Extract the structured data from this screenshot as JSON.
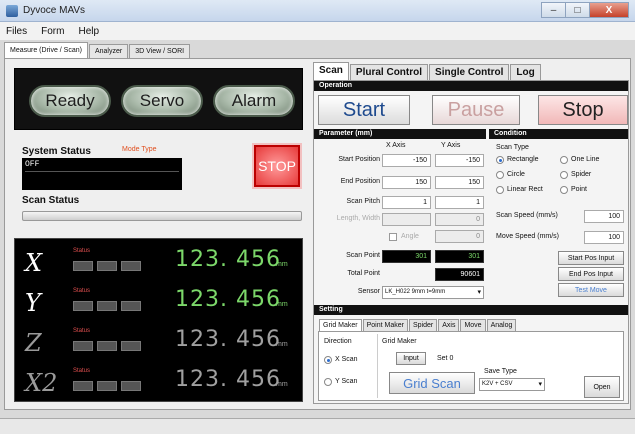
{
  "window": {
    "title": "Dyvoce MAVs",
    "minimize": "–",
    "maximize": "□",
    "close": "X"
  },
  "menu": [
    "Files",
    "Form",
    "Help"
  ],
  "top_tabs": [
    "Measure (Drive / Scan)",
    "Analyzer",
    "3D View / SORI"
  ],
  "lamps": {
    "ready": "Ready",
    "servo": "Servo",
    "alarm": "Alarm"
  },
  "system": {
    "label": "System Status",
    "mode_type": "Mode Type",
    "value": "OFF",
    "stop": "STOP"
  },
  "scan_status": {
    "label": "Scan Status"
  },
  "axes": [
    {
      "name": "X",
      "status": "Status",
      "value": "123. 456",
      "unit": "mm",
      "active": true
    },
    {
      "name": "Y",
      "status": "Status",
      "value": "123. 456",
      "unit": "mm",
      "active": true
    },
    {
      "name": "Z",
      "status": "Status",
      "value": "123. 456",
      "unit": "mm",
      "active": false
    },
    {
      "name": "X2",
      "status": "Status",
      "value": "123. 456",
      "unit": "mm",
      "active": false
    }
  ],
  "right_tabs": [
    "Scan",
    "Plural Control",
    "Single Control",
    "Log"
  ],
  "operation": {
    "header": "Operation",
    "start": "Start",
    "pause": "Pause",
    "stop": "Stop"
  },
  "parameter": {
    "header": "Parameter (mm)",
    "x_axis": "X Axis",
    "y_axis": "Y Axis",
    "start_position": {
      "label": "Start Position",
      "x": "-150",
      "y": "-150"
    },
    "end_position": {
      "label": "End  Position",
      "x": "150",
      "y": "150"
    },
    "scan_pitch": {
      "label": "Scan Pitch",
      "x": "1",
      "y": "1"
    },
    "length_width": {
      "label": "Length, Width",
      "y": "0"
    },
    "angle": {
      "label": "Angle",
      "y": "0"
    },
    "scan_point": {
      "label": "Scan Point",
      "x": "301",
      "y": "301"
    },
    "total_point": {
      "label": "Total Point",
      "value": "90601"
    },
    "sensor": {
      "label": "Sensor",
      "value": "LK_H022 9mm t=9mm"
    }
  },
  "condition": {
    "header": "Condition",
    "scan_type": "Scan Type",
    "options": [
      "Rectangle",
      "One Line",
      "Circle",
      "Spider",
      "Linear Rect",
      "Point"
    ],
    "selected": "Rectangle",
    "scan_speed": {
      "label": "Scan Speed (mm/s)",
      "value": "100"
    },
    "move_speed": {
      "label": "Move Speed (mm/s)",
      "value": "100"
    },
    "start_pos_input": "Start Pos Input",
    "end_pos_input": "End Pos Input",
    "test_move": "Test Move"
  },
  "setting": {
    "header": "Setting",
    "tabs": [
      "Grid Maker",
      "Point Maker",
      "Spider",
      "Axis",
      "Move",
      "Analog"
    ],
    "direction": "Direction",
    "x_scan": "X Scan",
    "y_scan": "Y Scan",
    "grid_maker": "Grid Maker",
    "input": "Input",
    "set": "Set 0",
    "grid_scan": "Grid Scan",
    "save_type_label": "Save Type",
    "save_type": "K2V + CSV",
    "open": "Open"
  }
}
